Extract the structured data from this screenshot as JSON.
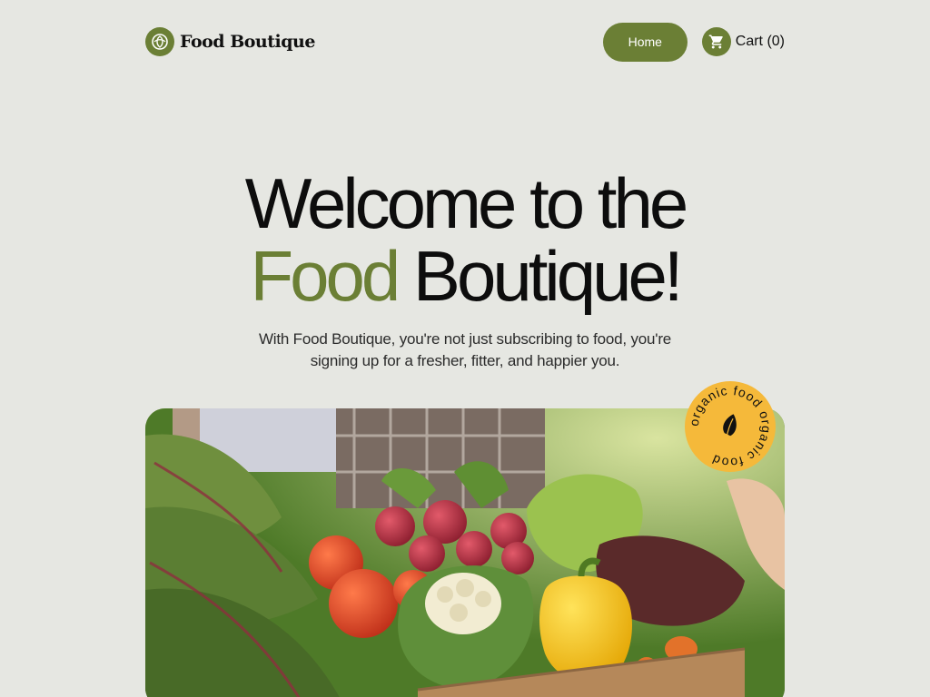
{
  "brand": {
    "name": "Food Boutique",
    "logo_icon": "leaf-seed-icon"
  },
  "nav": {
    "home_label": "Home",
    "cart_label": "Cart (0)",
    "cart_icon": "cart-icon"
  },
  "hero": {
    "title_line1": "Welcome to the",
    "title_accent": "Food",
    "title_rest": " Boutique!",
    "subtitle": "With Food Boutique, you're not just subscribing to food, you're signing up for a fresher, fitter, and happier you."
  },
  "badge": {
    "text": "organic food organic food",
    "icon": "leaf-icon"
  },
  "colors": {
    "accent": "#6b7f35",
    "background": "#e6e7e2",
    "badge": "#f5b93a"
  }
}
